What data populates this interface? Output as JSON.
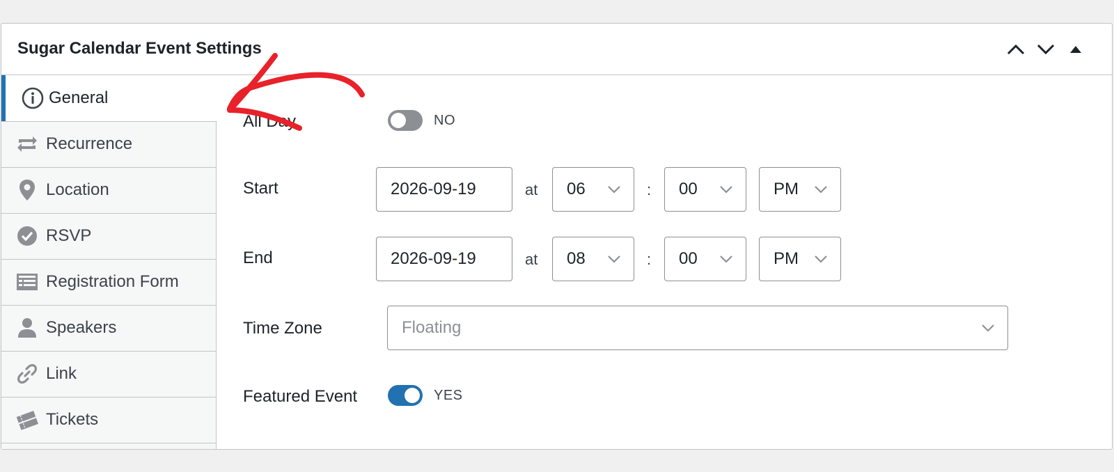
{
  "panel": {
    "title": "Sugar Calendar Event Settings"
  },
  "sidebar": {
    "items": [
      {
        "label": "General",
        "icon": "info-icon"
      },
      {
        "label": "Recurrence",
        "icon": "repeat-icon"
      },
      {
        "label": "Location",
        "icon": "location-pin-icon"
      },
      {
        "label": "RSVP",
        "icon": "check-circle-icon"
      },
      {
        "label": "Registration Form",
        "icon": "form-icon"
      },
      {
        "label": "Speakers",
        "icon": "person-icon"
      },
      {
        "label": "Link",
        "icon": "link-icon"
      },
      {
        "label": "Tickets",
        "icon": "tickets-icon"
      }
    ]
  },
  "form": {
    "all_day": {
      "label": "All Day",
      "state": "NO"
    },
    "start": {
      "label": "Start",
      "date": "2026-09-19",
      "at": "at",
      "hour": "06",
      "sep": ":",
      "minute": "00",
      "ampm": "PM"
    },
    "end": {
      "label": "End",
      "date": "2026-09-19",
      "at": "at",
      "hour": "08",
      "sep": ":",
      "minute": "00",
      "ampm": "PM"
    },
    "time_zone": {
      "label": "Time Zone",
      "value": "Floating"
    },
    "featured": {
      "label": "Featured Event",
      "state": "YES"
    }
  },
  "colors": {
    "accent": "#2271b1",
    "annotation_arrow": "#e8222a",
    "toggle_off": "#8c8f94"
  }
}
